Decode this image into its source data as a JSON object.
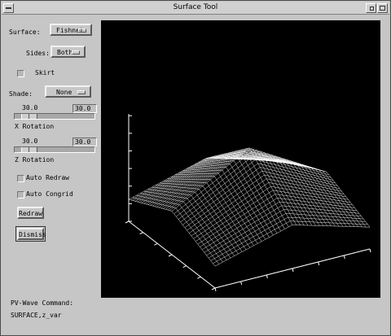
{
  "window": {
    "title": "Surface Tool"
  },
  "controls": {
    "surface_label": "Surface:",
    "surface_value": "Fishnet",
    "sides_label": "Sides:",
    "sides_value": "Both",
    "skirt_label": "Skirt",
    "skirt_checked": false,
    "shade_label": "Shade:",
    "shade_value": "None",
    "x_rotation": {
      "slider_value": "30.0",
      "field_value": "30.0",
      "label": "X Rotation"
    },
    "z_rotation": {
      "slider_value": "30.0",
      "field_value": "30.0",
      "label": "Z Rotation"
    },
    "auto_redraw_label": "Auto Redraw",
    "auto_redraw_checked": false,
    "auto_congrid_label": "Auto Congrid",
    "auto_congrid_checked": false,
    "redraw_label": "Redraw",
    "dismiss_label": "Dismiss"
  },
  "command": {
    "label": "PV-Wave Command:",
    "text": "SURFACE,z_var"
  },
  "plot": {
    "type": "surface-fishnet",
    "background": "#000000",
    "line_color": "#ffffff",
    "x_rotation_deg": 30,
    "z_rotation_deg": 30,
    "z_range": [
      0,
      60
    ],
    "grid_size": 40
  }
}
